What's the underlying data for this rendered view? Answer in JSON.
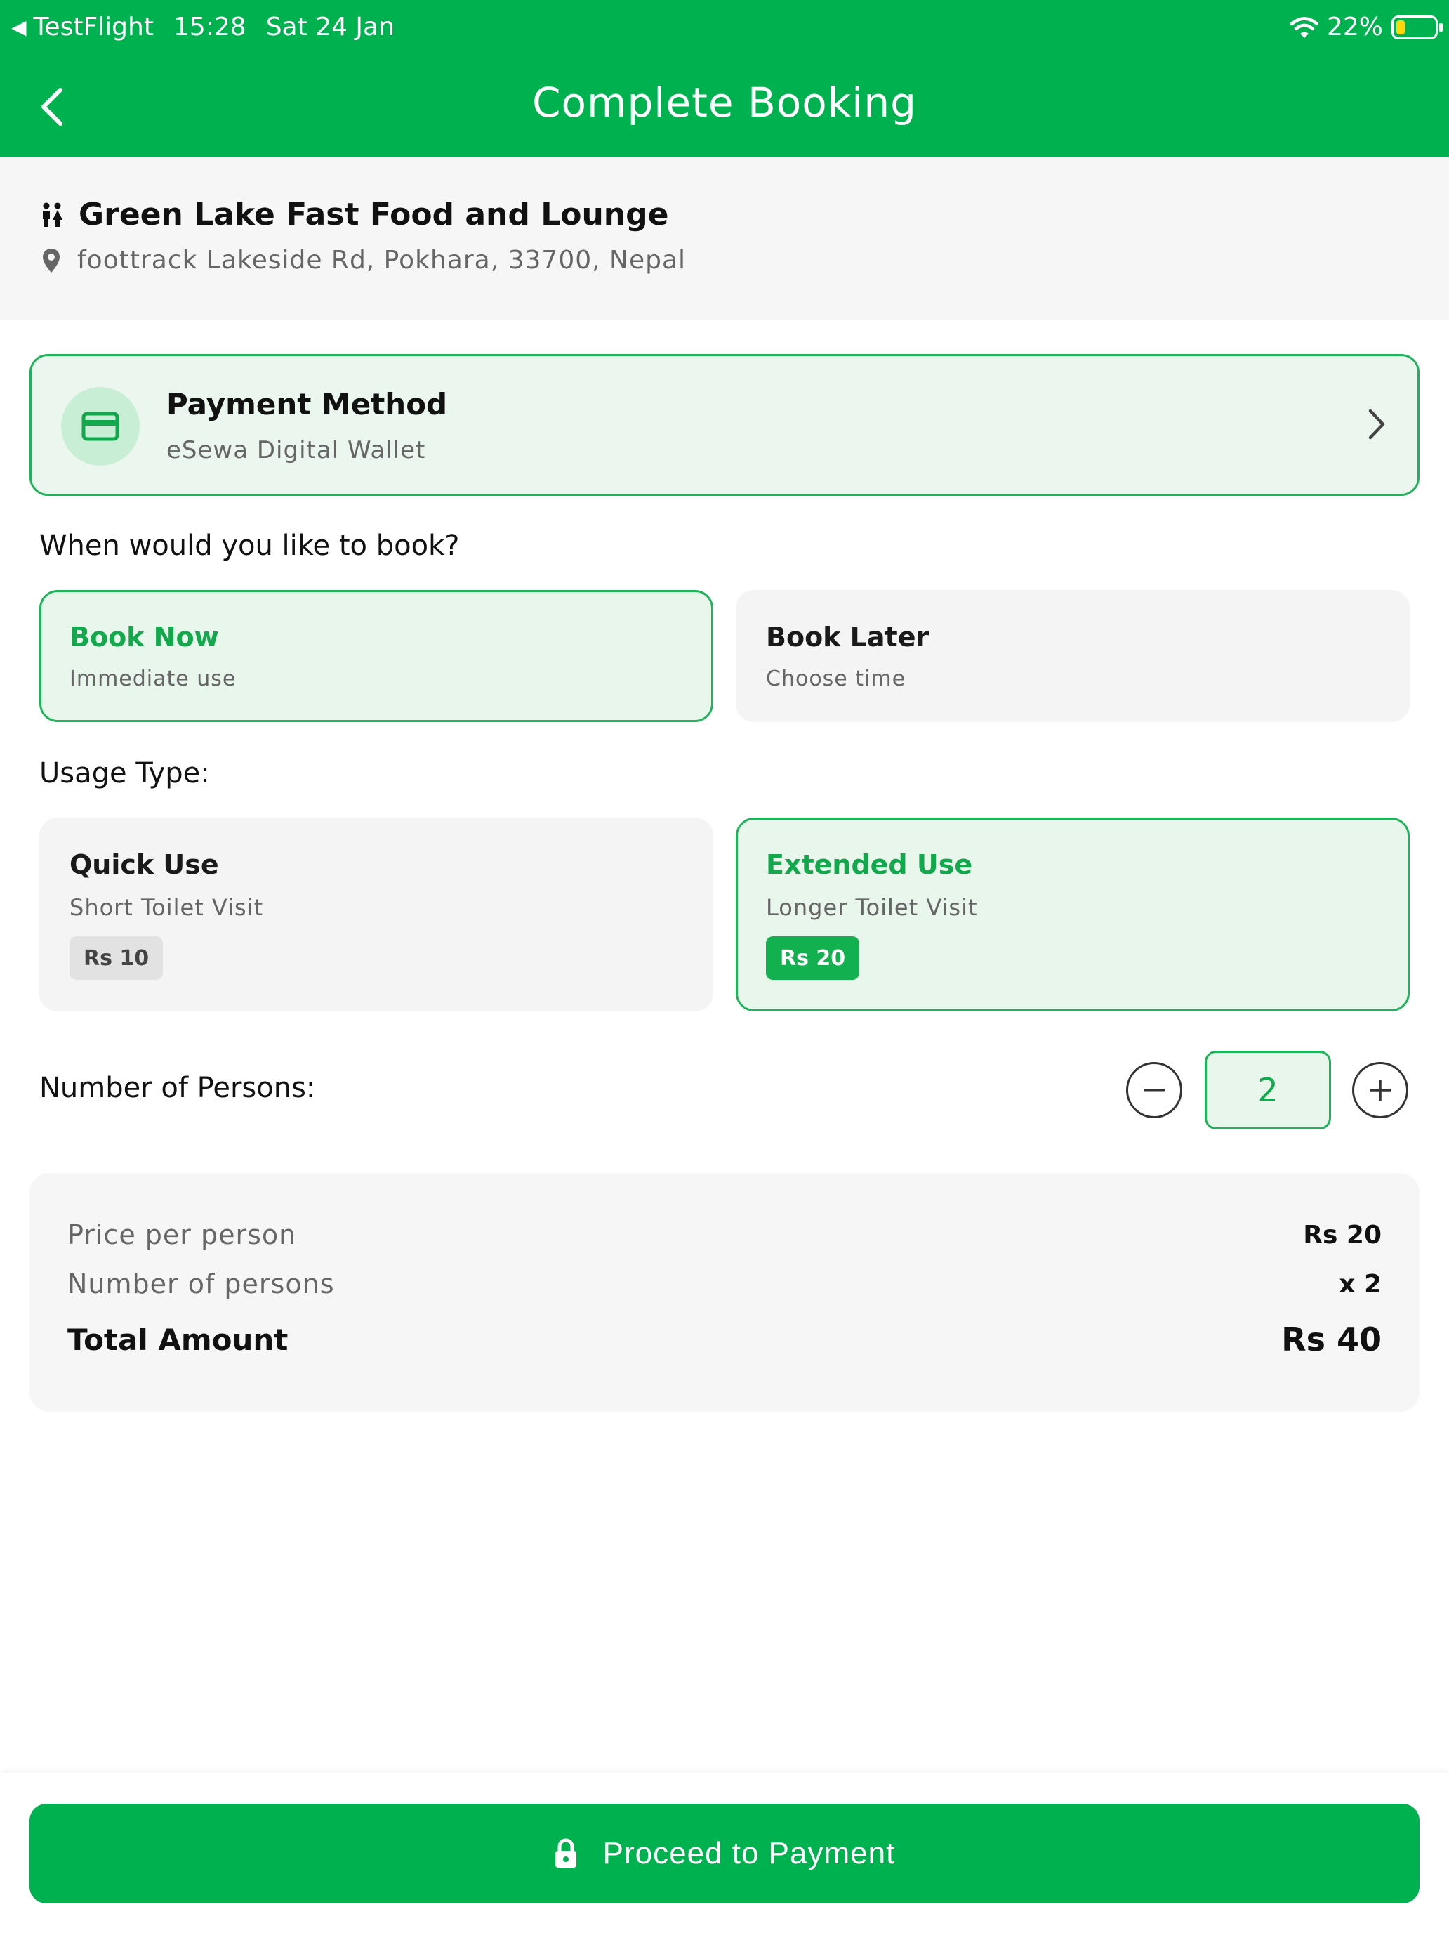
{
  "status_bar": {
    "app": "TestFlight",
    "time": "15:28",
    "date": "Sat 24 Jan",
    "battery": "22%",
    "battery_level": 0.22
  },
  "header": {
    "title": "Complete Booking",
    "back_icon": "chevron-left-icon"
  },
  "venue": {
    "name": "Green Lake Fast Food and Lounge",
    "address": "foottrack Lakeside Rd, Pokhara, 33700, Nepal",
    "icons": [
      "restroom-icon",
      "location-pin-icon"
    ]
  },
  "payment": {
    "title": "Payment Method",
    "method": "eSewa Digital Wallet",
    "icon": "credit-card-icon"
  },
  "booking_time": {
    "label": "When would you like to book?",
    "options": [
      {
        "title": "Book Now",
        "subtitle": "Immediate use",
        "selected": true
      },
      {
        "title": "Book Later",
        "subtitle": "Choose time",
        "selected": false
      }
    ]
  },
  "usage": {
    "label": "Usage Type:",
    "options": [
      {
        "title": "Quick Use",
        "subtitle": "Short Toilet Visit",
        "price": "Rs 10",
        "selected": false
      },
      {
        "title": "Extended Use",
        "subtitle": "Longer Toilet Visit",
        "price": "Rs 20",
        "selected": true
      }
    ]
  },
  "persons": {
    "label": "Number of Persons:",
    "value": "2"
  },
  "summary": {
    "price_label": "Price per person",
    "price_value": "Rs 20",
    "persons_label": "Number of persons",
    "persons_value": "x 2",
    "total_label": "Total Amount",
    "total_value": "Rs 40"
  },
  "cta": {
    "label": "Proceed to Payment",
    "icon": "lock-icon"
  },
  "colors": {
    "primary": "#00b14f",
    "selected_bg": "#e8f6ec",
    "battery": "#ffd60a"
  }
}
